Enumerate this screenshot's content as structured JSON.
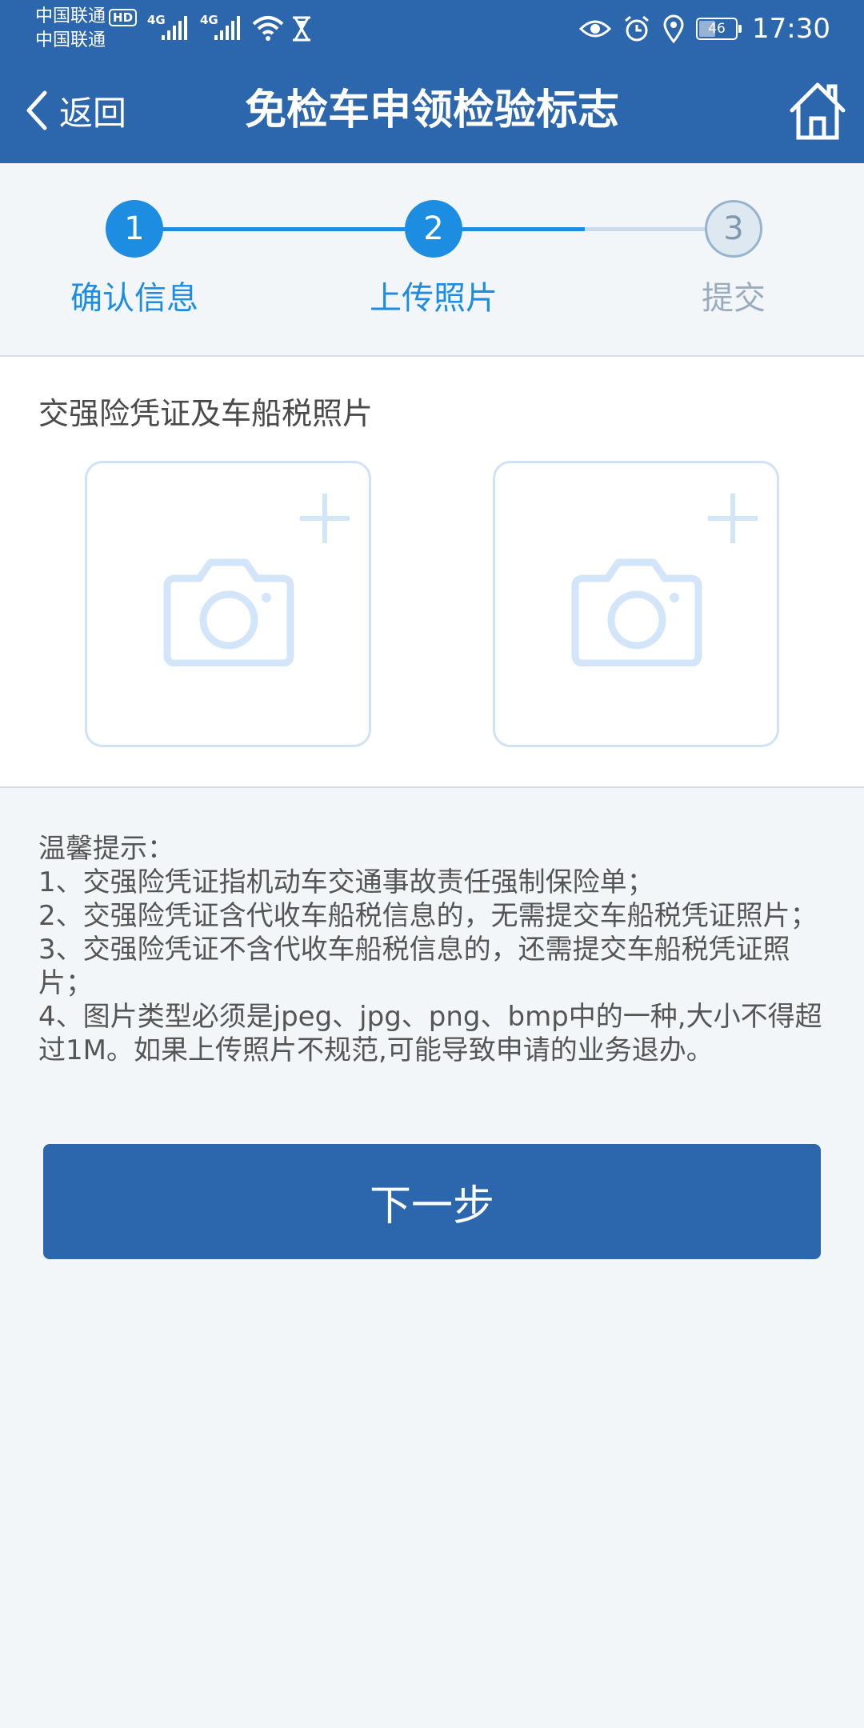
{
  "status_bar": {
    "carrier_1": "中国联通",
    "carrier_2": "中国联通",
    "hd_badge": "HD",
    "network_1": "4G",
    "network_2": "4G",
    "battery_level": "46",
    "battery_fraction": 0.46,
    "time": "17:30"
  },
  "header": {
    "back_label": "返回",
    "title": "免检车申领检验标志",
    "home_icon": "home-icon"
  },
  "steps": [
    {
      "number": "1",
      "label": "确认信息",
      "state": "active"
    },
    {
      "number": "2",
      "label": "上传照片",
      "state": "active"
    },
    {
      "number": "3",
      "label": "提交",
      "state": "pending"
    }
  ],
  "upload": {
    "section_title": "交强险凭证及车船税照片",
    "slots": [
      {
        "icon": "camera-icon",
        "add_icon": "plus-icon"
      },
      {
        "icon": "camera-icon",
        "add_icon": "plus-icon"
      }
    ]
  },
  "tips": {
    "heading": "温馨提示：",
    "lines": [
      "1、交强险凭证指机动车交通事故责任强制保险单；",
      "2、交强险凭证含代收车船税信息的，无需提交车船税凭证照片；",
      "3、交强险凭证不含代收车船税信息的，还需提交车船税凭证照片；",
      "4、图片类型必须是jpeg、jpg、png、bmp中的一种,大小不得超过1M。如果上传照片不规范,可能导致申请的业务退办。"
    ]
  },
  "next_button": "下一步",
  "colors": {
    "primary": "#2c66ac",
    "step_active": "#1c8de0",
    "step_pending": "#9aabbd",
    "upload_border": "#cfe2f6"
  }
}
